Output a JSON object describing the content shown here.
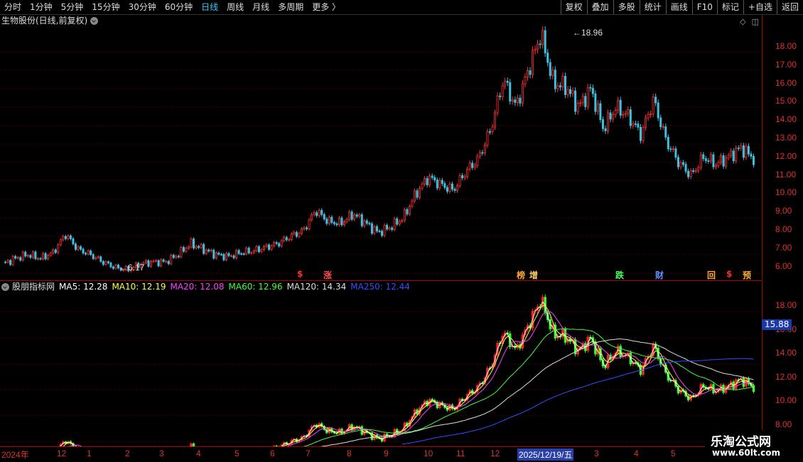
{
  "toolbar": {
    "periods": [
      "分时",
      "1分钟",
      "5分钟",
      "15分钟",
      "30分钟",
      "60分钟",
      "日线",
      "周线",
      "月线",
      "多周期",
      "更多 〉"
    ],
    "active_index": 6,
    "right_buttons": [
      "复权",
      "叠加",
      "多股",
      "统计",
      "画线",
      "F10",
      "标记",
      "+自选",
      "返回"
    ]
  },
  "main_panel": {
    "title": "生物股份(日线,前复权)",
    "high_label": "18.96",
    "low_label": "6.17",
    "y_ticks": [
      "18.00",
      "17.00",
      "16.00",
      "15.00",
      "14.00",
      "13.00",
      "12.00",
      "11.00",
      "10.00",
      "9.00",
      "8.00",
      "7.00",
      "6.00"
    ],
    "events": [
      {
        "text": "$",
        "color": "#ff3030"
      },
      {
        "text": "涨",
        "color": "#ff5050"
      },
      {
        "text": "榜",
        "color": "#ffaa30"
      },
      {
        "text": "增",
        "color": "#ffcc60"
      },
      {
        "text": "跌",
        "color": "#40ff60"
      },
      {
        "text": "财",
        "color": "#6090ff"
      },
      {
        "text": "回",
        "color": "#ffaa30"
      },
      {
        "text": "$",
        "color": "#ff3030"
      },
      {
        "text": "预",
        "color": "#ffaa30"
      }
    ]
  },
  "indicator_panel": {
    "name": "股朋指标网",
    "ma": [
      {
        "label": "MA5: 12.28",
        "color": "#ffffff"
      },
      {
        "label": "MA10: 12.19",
        "color": "#ffff40"
      },
      {
        "label": "MA20: 12.08",
        "color": "#ff40ff"
      },
      {
        "label": "MA60: 12.96",
        "color": "#40ff40"
      },
      {
        "label": "MA120: 14.34",
        "color": "#dddddd"
      },
      {
        "label": "MA250: 12.44",
        "color": "#3050ff"
      }
    ],
    "price_tag": "15.88",
    "y_ticks": [
      "18.00",
      "16.00",
      "14.00",
      "12.00",
      "10.00",
      "8.00"
    ]
  },
  "x_axis": {
    "labels": [
      "2024年",
      "12",
      "1",
      "2",
      "3",
      "4",
      "5",
      "6",
      "7",
      "8",
      "9",
      "10",
      "11",
      "12",
      "2025/12/19/五",
      "3",
      "4",
      "5"
    ]
  },
  "chart_data": {
    "type": "candlestick",
    "series": [
      {
        "name": "生物股份",
        "values": [
          6.5,
          6.8,
          7.0,
          6.8,
          7.1,
          8.1,
          7.3,
          7.0,
          6.6,
          6.3,
          6.17,
          6.5,
          6.6,
          6.6,
          7.0,
          7.6,
          7.3,
          7.0,
          6.9,
          7.1,
          7.2,
          7.4,
          7.6,
          8.0,
          8.3,
          9.4,
          8.8,
          8.7,
          9.2,
          8.7,
          8.2,
          8.5,
          9.0,
          10.3,
          11.2,
          10.8,
          10.5,
          11.5,
          12.2,
          13.8,
          16.5,
          15.0,
          17.0,
          18.96,
          16.3,
          16.1,
          15.0,
          16.0,
          13.8,
          15.0,
          14.5,
          13.5,
          15.4,
          13.2,
          12.0,
          11.3,
          12.3,
          11.9,
          12.3,
          12.8,
          12.2
        ]
      }
    ],
    "ylim": [
      6.0,
      19.0
    ]
  },
  "watermark": {
    "line1": "乐淘公式网",
    "line2": "www.60lt.com"
  }
}
